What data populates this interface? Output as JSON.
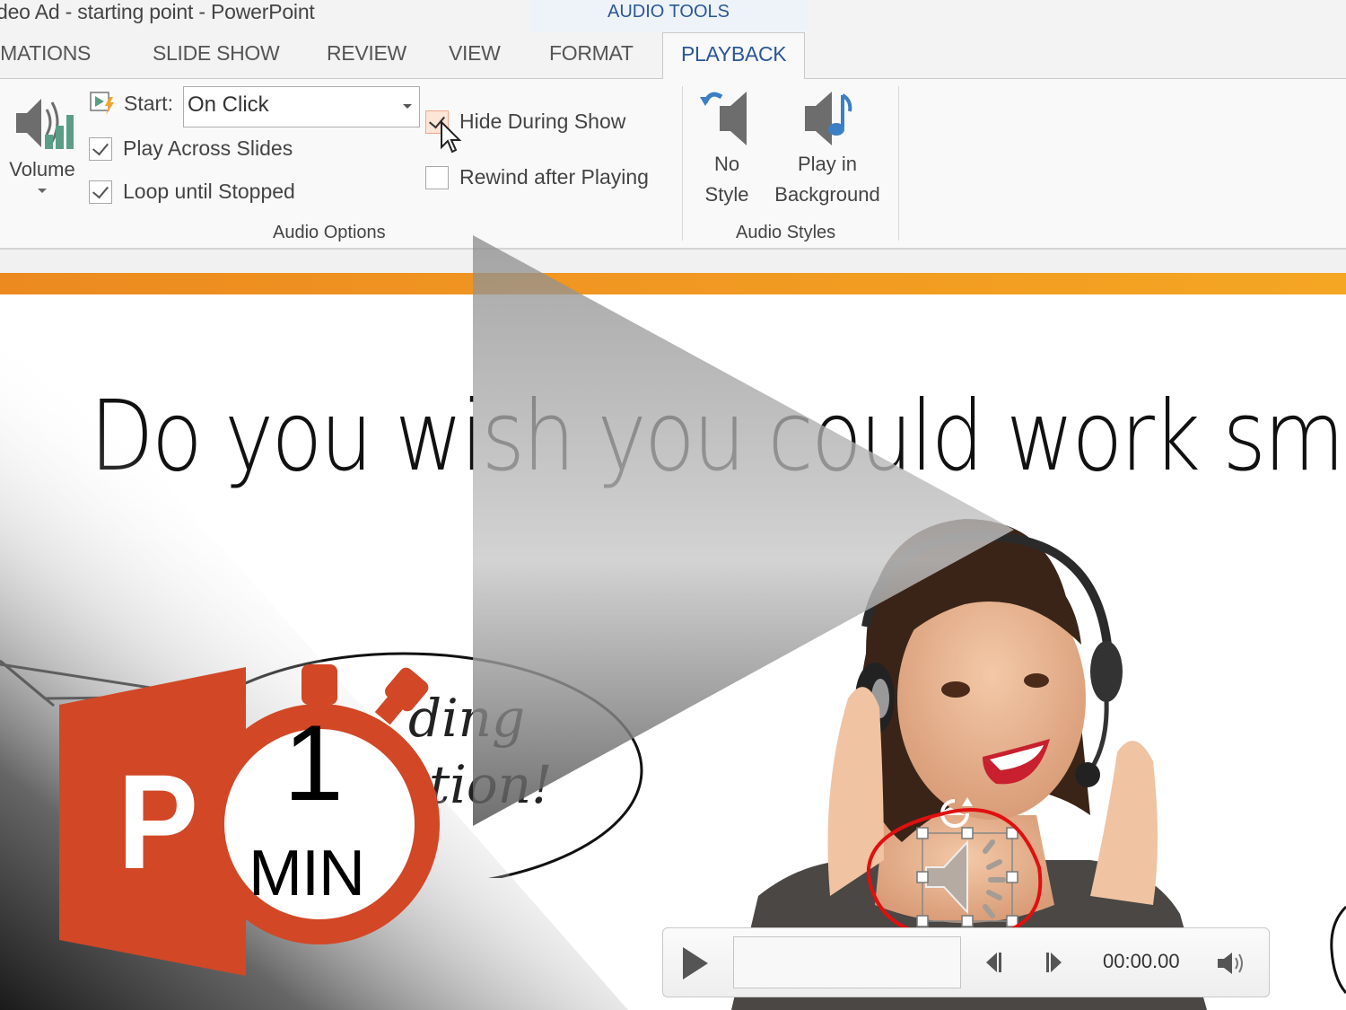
{
  "window": {
    "title": "deo Ad - starting point - PowerPoint",
    "contextual_group": "AUDIO TOOLS"
  },
  "tabs": [
    {
      "label": "IMATIONS",
      "active": false
    },
    {
      "label": "SLIDE SHOW",
      "active": false
    },
    {
      "label": "REVIEW",
      "active": false
    },
    {
      "label": "VIEW",
      "active": false
    },
    {
      "label": "FORMAT",
      "active": false
    },
    {
      "label": "PLAYBACK",
      "active": true
    }
  ],
  "ribbon": {
    "volume": {
      "label": "Volume",
      "icon": "volume-icon"
    },
    "start": {
      "label": "Start:",
      "value": "On Click",
      "icon": "animation-trigger-icon"
    },
    "checkboxes": [
      {
        "label": "Play Across Slides",
        "checked": true
      },
      {
        "label": "Loop until Stopped",
        "checked": true
      },
      {
        "label": "Hide During Show",
        "checked": true,
        "hovered": true
      },
      {
        "label": "Rewind after Playing",
        "checked": false
      }
    ],
    "audio_options_label": "Audio Options",
    "styles": [
      {
        "line1": "No",
        "line2": "Style",
        "icon": "no-style-icon"
      },
      {
        "line1": "Play in",
        "line2": "Background",
        "icon": "play-in-background-icon"
      }
    ],
    "audio_styles_label": "Audio Styles"
  },
  "slide": {
    "headline": "Do you wish you could work sm",
    "bubble_line1": "ding",
    "bubble_line2": "tion!",
    "accent_bar_color": "#F0922A"
  },
  "player": {
    "time": "00:00.00",
    "progress_percent": 0
  },
  "overlay": {
    "logo_number": "1",
    "logo_unit": "MIN",
    "logo_letter": "P",
    "brand_color": "#D24726"
  }
}
